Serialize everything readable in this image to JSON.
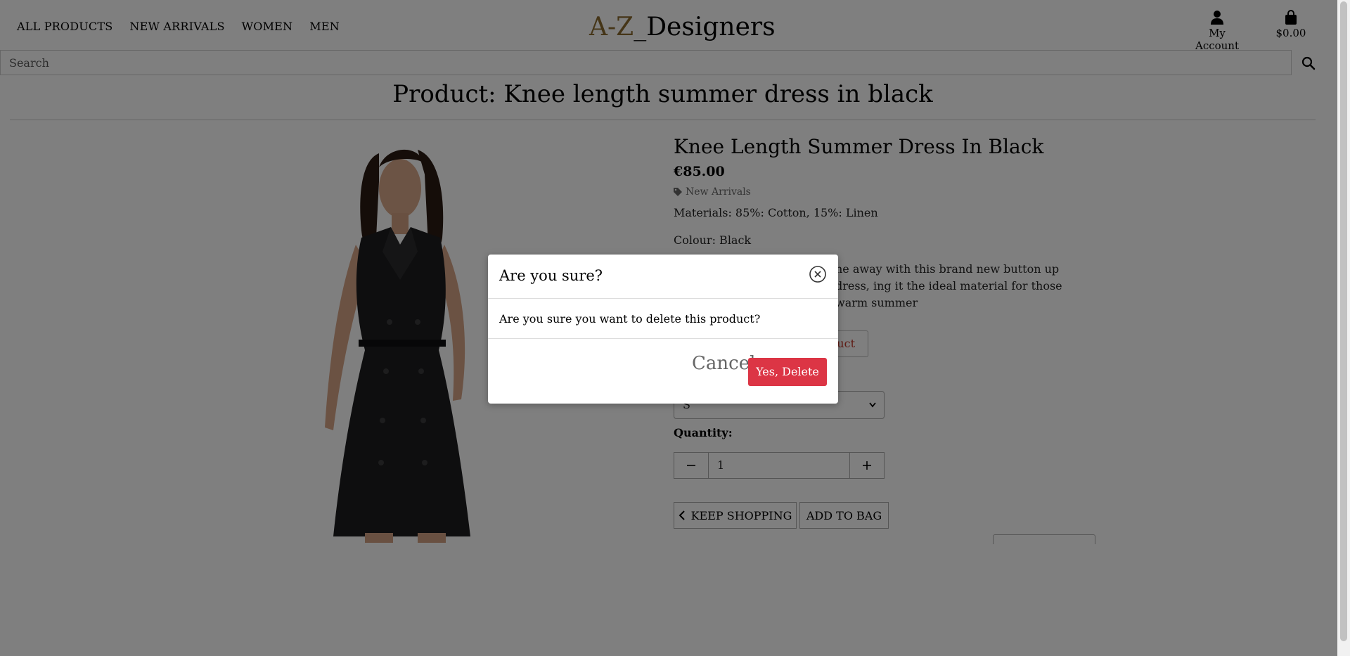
{
  "header": {
    "nav": [
      "ALL PRODUCTS",
      "NEW ARRIVALS",
      "WOMEN",
      "MEN"
    ],
    "logo_part1": "A-Z",
    "logo_part2": "_Designers",
    "account_label": "My Account",
    "bag_total": "$0.00"
  },
  "search": {
    "placeholder": "Search"
  },
  "page_title": "Product: Knee length summer dress in black",
  "product": {
    "name": "Knee Length Summer Dress In Black",
    "price": "€85.00",
    "category": "New Arrivals",
    "materials": "Materials: 85%: Cotton, 15%: Linen",
    "colour": "Colour: Black",
    "description": "ne away with this brand new button up dress, ing it the ideal material for those warm summer",
    "delete_label_partial": "duct",
    "size_value": "S",
    "quantity_label": "Quantity:",
    "quantity_value": "1",
    "keep_shopping": "KEEP SHOPPING",
    "add_to_bag": "ADD TO BAG"
  },
  "modal": {
    "title": "Are you sure?",
    "body": "Are you sure you want to delete this product?",
    "cancel": "Cancel",
    "confirm": "Yes, Delete"
  },
  "colors": {
    "danger": "#dc3545",
    "logo_accent": "#8a6a2f",
    "overlay": "rgba(0,0,0,0.5)"
  }
}
